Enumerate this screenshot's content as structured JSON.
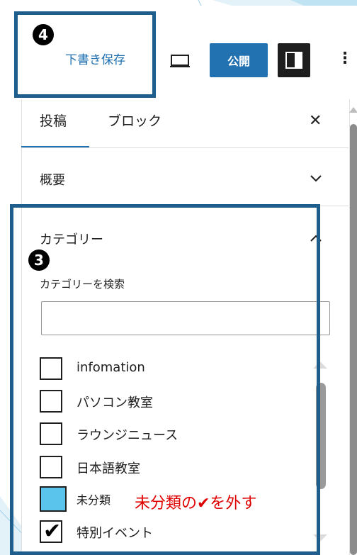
{
  "header": {
    "draft_label": "下書き保存",
    "publish_label": "公開",
    "more_glyph": "⋮"
  },
  "tabs": [
    {
      "label": "投稿",
      "active": true
    },
    {
      "label": "ブロック",
      "active": false
    }
  ],
  "close_glyph": "✕",
  "sections": {
    "summary_title": "概要",
    "category_title": "カテゴリー",
    "search_label": "カテゴリーを検索",
    "search_value": ""
  },
  "categories": [
    {
      "label": "infomation",
      "checked": false
    },
    {
      "label": "パソコン教室",
      "checked": false
    },
    {
      "label": "ラウンジニュース",
      "checked": false
    },
    {
      "label": "日本語教室",
      "checked": false
    },
    {
      "label": "未分類",
      "checked": false,
      "highlighted": true
    },
    {
      "label": "特別イベント",
      "checked": true
    }
  ],
  "check_glyph": "✔",
  "annotations": {
    "badge_4": "4",
    "badge_3": "3",
    "note": "未分類の✔を外す"
  },
  "colors": {
    "accent": "#2271b1",
    "highlight_box": "#1f5d8c",
    "annotation_red": "#e00000",
    "unselected_highlight": "#5bc4ec"
  },
  "icons": [
    "preview-desktop-icon",
    "sidebar-settings-icon",
    "more-options-icon",
    "close-icon",
    "chevron-down-icon",
    "chevron-up-icon",
    "check-icon"
  ]
}
